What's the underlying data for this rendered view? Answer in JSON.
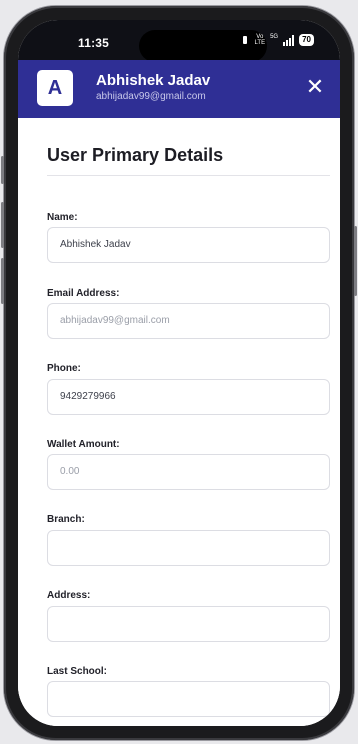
{
  "status_bar": {
    "time": "11:35",
    "volte": [
      "Vo",
      "LTE"
    ],
    "network": "5G",
    "battery": "70"
  },
  "header": {
    "avatar_initial": "A",
    "user_name": "Abhishek Jadav",
    "user_email": "abhijadav99@gmail.com",
    "close_glyph": "✕"
  },
  "section": {
    "title": "User Primary Details"
  },
  "fields": [
    {
      "label": "Name:",
      "value": "Abhishek Jadav"
    },
    {
      "label": "Email Address:",
      "value": "abhijadav99@gmail.com"
    },
    {
      "label": "Phone:",
      "value": "9429279966"
    },
    {
      "label": "Wallet Amount:",
      "value": "0.00"
    },
    {
      "label": "Branch:",
      "value": ""
    },
    {
      "label": "Address:",
      "value": ""
    },
    {
      "label": "Last School:",
      "value": ""
    }
  ],
  "colors": {
    "header_bg": "#2f2f95",
    "status_bar_bg": "#0f1016"
  }
}
